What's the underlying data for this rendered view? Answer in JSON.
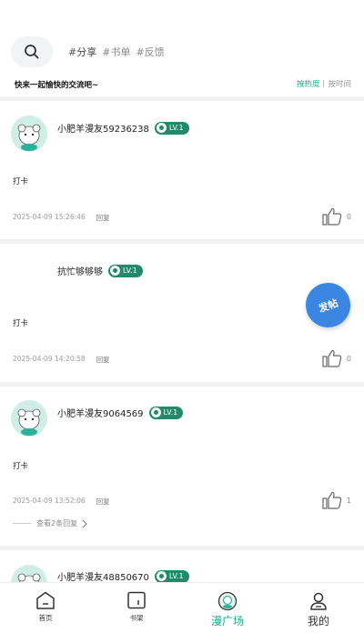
{
  "search": {
    "icon": "search-icon"
  },
  "tags": [
    {
      "hash": "#",
      "text": "分享"
    },
    {
      "hash": "#",
      "text": "书单"
    },
    {
      "hash": "#",
      "text": "反馈"
    }
  ],
  "slogan": "快来一起愉快的交流吧~",
  "sort": {
    "hot": "按热度",
    "time": "按时间"
  },
  "posts": [
    {
      "username": "小肥羊漫友59236238",
      "level": "LV.1",
      "content": "打卡",
      "time": "2025-04-09 15:26:46",
      "reply": "回复",
      "likes": "0"
    },
    {
      "username": "抗忙够够够",
      "level": "LV.1",
      "content": "打卡",
      "time": "2025-04-09 14:20:58",
      "reply": "回复",
      "likes": "0"
    },
    {
      "username": "小肥羊漫友9064569",
      "level": "LV.1",
      "content": "打卡",
      "time": "2025-04-09 13:52:06",
      "reply": "回复",
      "likes": "1",
      "more_replies": "查看2条回复"
    },
    {
      "username": "小肥羊漫友48850670",
      "level": "LV.1"
    }
  ],
  "float_button": {
    "label": "发帖"
  },
  "tabbar": [
    {
      "label": "首页",
      "icon": "home-icon"
    },
    {
      "label": "书架",
      "icon": "bookshelf-icon"
    },
    {
      "label": "漫广场",
      "icon": "square-icon",
      "active": true
    },
    {
      "label": "我的",
      "icon": "profile-icon"
    }
  ],
  "colors": {
    "accent": "#1aae8f",
    "level_badge": "#218a6b",
    "float_button": "#3b86e3"
  }
}
